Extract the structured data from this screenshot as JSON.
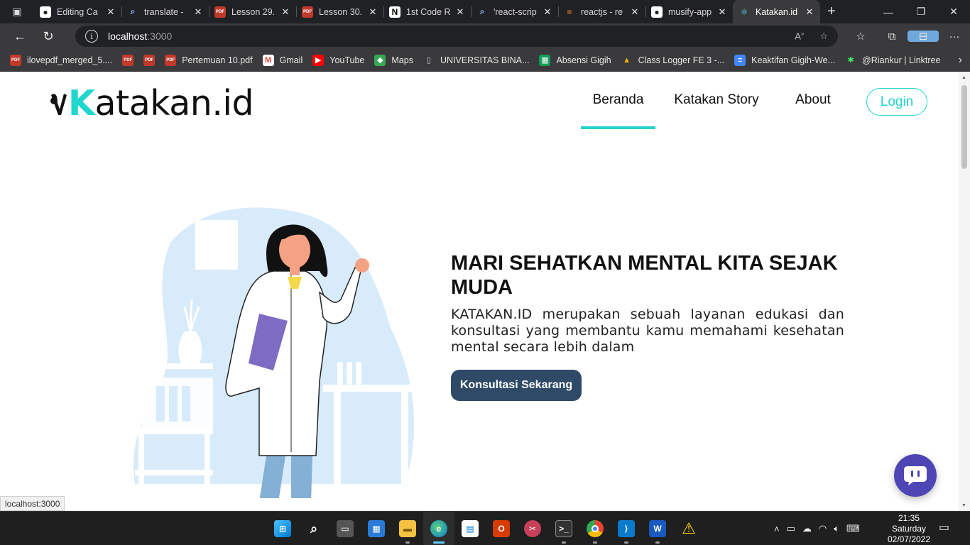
{
  "browser": {
    "tabs": [
      {
        "title": "Editing Ca",
        "icon": "github-icon",
        "active": false
      },
      {
        "title": "translate -",
        "icon": "search-icon",
        "active": false
      },
      {
        "title": "Lesson 29.",
        "icon": "pdf-icon",
        "active": false
      },
      {
        "title": "Lesson 30.",
        "icon": "pdf-icon",
        "active": false
      },
      {
        "title": "1st Code R",
        "icon": "notion-icon",
        "active": false
      },
      {
        "title": "'react-scrip",
        "icon": "search-icon",
        "active": false
      },
      {
        "title": "reactjs - re",
        "icon": "stackoverflow-icon",
        "active": false
      },
      {
        "title": "musify-app",
        "icon": "github-icon",
        "active": false
      },
      {
        "title": "Katakan.id",
        "icon": "react-icon",
        "active": true
      }
    ],
    "url_host": "localhost",
    "url_port": ":3000",
    "bookmarks": [
      {
        "label": "ilovepdf_merged_5....",
        "icon": "pdf-icon"
      },
      {
        "label": "",
        "icon": "pdf-icon"
      },
      {
        "label": "",
        "icon": "pdf-icon"
      },
      {
        "label": "Pertemuan 10.pdf",
        "icon": "pdf-icon"
      },
      {
        "label": "Gmail",
        "icon": "gmail-icon"
      },
      {
        "label": "YouTube",
        "icon": "youtube-icon"
      },
      {
        "label": "Maps",
        "icon": "maps-icon"
      },
      {
        "label": "UNIVERSITAS BINA...",
        "icon": "page-icon"
      },
      {
        "label": "Absensi Gigih",
        "icon": "sheets-icon"
      },
      {
        "label": "Class Logger FE 3 -...",
        "icon": "drive-icon"
      },
      {
        "label": "Keaktifan Gigih-We...",
        "icon": "docs-icon"
      },
      {
        "label": "@Riankur | Linktree",
        "icon": "linktree-icon"
      }
    ],
    "status_url": "localhost:3000"
  },
  "site": {
    "logo_k": "K",
    "logo_rest": "atakan.id",
    "nav": [
      {
        "label": "Beranda",
        "active": true
      },
      {
        "label": "Katakan Story",
        "active": false
      },
      {
        "label": "About",
        "active": false
      }
    ],
    "login_label": "Login",
    "hero": {
      "title": "MARI SEHATKAN MENTAL KITA SEJAK MUDA",
      "description": "KATAKAN.ID merupakan sebuah layanan edukasi dan konsultasi yang membantu kamu memahami kesehatan mental secara lebih dalam",
      "cta_label": "Konsultasi Sekarang"
    },
    "colors": {
      "accent": "#22d3cb",
      "cta": "#2f4a66",
      "chat_fab": "#4e46b4"
    }
  },
  "taskbar": {
    "apps": [
      "windows-start-icon",
      "search-icon",
      "task-view-icon",
      "widgets-icon",
      "file-explorer-icon",
      "edge-icon",
      "microsoft-store-icon",
      "office-icon",
      "snipping-icon",
      "terminal-icon",
      "chrome-icon",
      "vscode-icon",
      "word-icon",
      "warning-icon"
    ],
    "time": "21:35",
    "day": "Saturday",
    "date": "02/07/2022"
  }
}
